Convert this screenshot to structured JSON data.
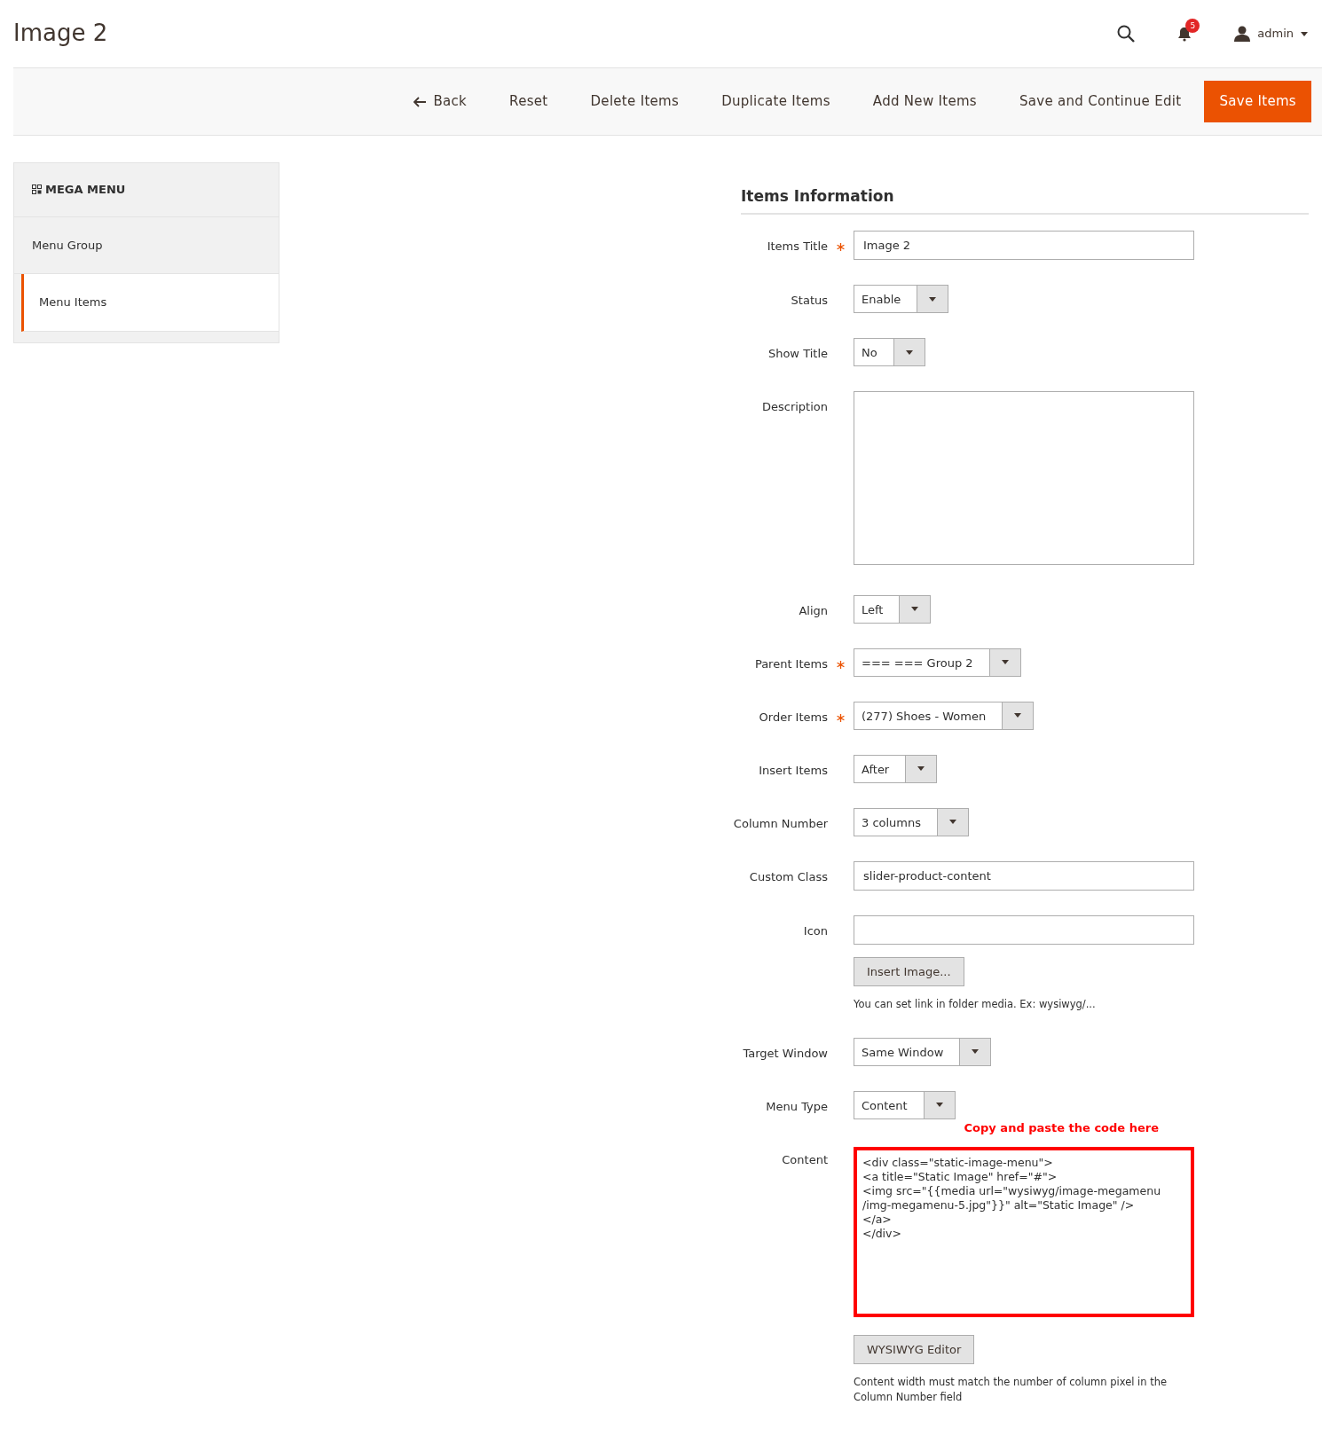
{
  "page_title": "Image 2",
  "header": {
    "notification_count": "5",
    "user": "admin"
  },
  "toolbar": [
    {
      "label": "Back",
      "kind": "back"
    },
    {
      "label": "Reset",
      "kind": "plain"
    },
    {
      "label": "Delete Items",
      "kind": "plain"
    },
    {
      "label": "Duplicate Items",
      "kind": "plain"
    },
    {
      "label": "Add New Items",
      "kind": "plain"
    },
    {
      "label": "Save and Continue Edit",
      "kind": "plain"
    },
    {
      "label": "Save Items",
      "kind": "primary"
    }
  ],
  "sidebar": {
    "title": "MEGA MENU",
    "items": [
      {
        "label": "Menu Group",
        "selected": false
      },
      {
        "label": "Menu Items",
        "selected": true
      }
    ]
  },
  "section_title": "Items Information",
  "fields": [
    {
      "label": "Items Title",
      "required": true,
      "kind": "text",
      "value": "Image 2"
    },
    {
      "label": "Status",
      "required": false,
      "kind": "select",
      "value": "Enable"
    },
    {
      "label": "Show Title",
      "required": false,
      "kind": "select",
      "value": "No"
    },
    {
      "label": "Description",
      "required": false,
      "kind": "textarea",
      "highlighted": false
    },
    {
      "label": "Align",
      "required": false,
      "kind": "select",
      "value": "Left"
    },
    {
      "label": "Parent Items",
      "required": true,
      "kind": "select",
      "value": "=== === Group 2"
    },
    {
      "label": "Order Items",
      "required": true,
      "kind": "select",
      "value": "(277) Shoes - Women"
    },
    {
      "label": "Insert Items",
      "required": false,
      "kind": "select",
      "value": "After"
    },
    {
      "label": "Column Number",
      "required": false,
      "kind": "select",
      "value": "3 columns"
    },
    {
      "label": "Custom Class",
      "required": false,
      "kind": "text",
      "value": "slider-product-content"
    },
    {
      "label": "Icon",
      "required": false,
      "kind": "text",
      "button": "Insert Image...",
      "note": "You can set link in folder media. Ex: wysiwyg/..."
    },
    {
      "label": "Target Window",
      "required": false,
      "kind": "select",
      "value": "Same Window"
    },
    {
      "label": "Menu Type",
      "required": false,
      "kind": "select",
      "value": "Content"
    },
    {
      "label": "Content",
      "required": false,
      "kind": "textarea",
      "highlighted": true,
      "annotation": "Copy and paste the code here",
      "value": [
        "<div class=\"static-image-menu\">",
        "<a title=\"Static Image\" href=\"#\">",
        "<img src=\"{{media url=\"wysiwyg/image-megamenu",
        "/img-megamenu-5.jpg\"}}\" alt=\"Static Image\" />",
        "</a>",
        "</div>"
      ],
      "button": "WYSIWYG Editor",
      "note": "Content width must match the number of column pixel in the Column Number field"
    }
  ]
}
